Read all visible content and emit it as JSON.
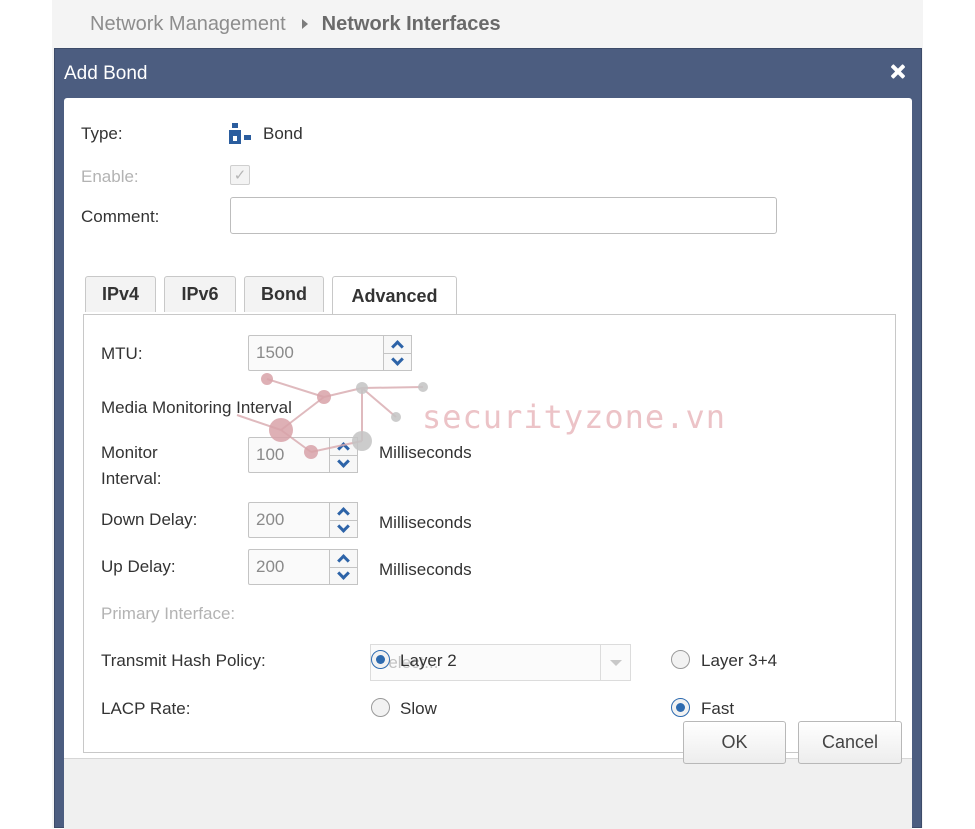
{
  "breadcrumb": {
    "parent": "Network Management",
    "current": "Network Interfaces"
  },
  "dialog": {
    "title": "Add Bond",
    "type_label": "Type:",
    "type_value": "Bond",
    "enable_label": "Enable:",
    "enable_checked": true,
    "comment_label": "Comment:",
    "comment_value": ""
  },
  "tabs": [
    {
      "label": "IPv4",
      "active": false
    },
    {
      "label": "IPv6",
      "active": false
    },
    {
      "label": "Bond",
      "active": false
    },
    {
      "label": "Advanced",
      "active": true
    }
  ],
  "advanced": {
    "mtu_label": "MTU:",
    "mtu_value": "1500",
    "media_monitoring_label": "Media Monitoring Interval",
    "monitor_interval_label_1": "Monitor",
    "monitor_interval_label_2": "Interval:",
    "monitor_interval_value": "100",
    "down_delay_label": "Down Delay:",
    "down_delay_value": "200",
    "up_delay_label": "Up Delay:",
    "up_delay_value": "200",
    "unit_ms": "Milliseconds",
    "primary_interface_label": "Primary Interface:",
    "primary_interface_placeholder": "Select...",
    "transmit_hash_label": "Transmit Hash Policy:",
    "transmit_hash_options": [
      "Layer 2",
      "Layer 3+4"
    ],
    "transmit_hash_selected": "Layer 2",
    "lacp_label": "LACP Rate:",
    "lacp_options": [
      "Slow",
      "Fast"
    ],
    "lacp_selected": "Fast"
  },
  "footer": {
    "ok_label": "OK",
    "cancel_label": "Cancel"
  },
  "watermark": {
    "text": "securityzone.vn"
  },
  "colors": {
    "titlebar": "#4c5d80",
    "accent": "#2e6bb0",
    "highlight": "#e0202a"
  }
}
